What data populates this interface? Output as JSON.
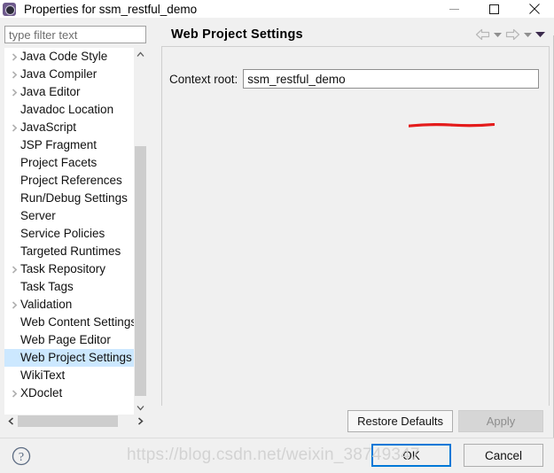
{
  "window": {
    "title": "Properties for ssm_restful_demo",
    "icon": "properties-gear-icon",
    "controls": {
      "minimize": "minimize-icon",
      "maximize": "maximize-icon",
      "close": "close-icon"
    }
  },
  "sidebar": {
    "filter": {
      "placeholder": "type filter text",
      "value": ""
    },
    "items": [
      {
        "label": "Java Code Style",
        "expandable": true,
        "selected": false
      },
      {
        "label": "Java Compiler",
        "expandable": true,
        "selected": false
      },
      {
        "label": "Java Editor",
        "expandable": true,
        "selected": false
      },
      {
        "label": "Javadoc Location",
        "expandable": false,
        "selected": false
      },
      {
        "label": "JavaScript",
        "expandable": true,
        "selected": false
      },
      {
        "label": "JSP Fragment",
        "expandable": false,
        "selected": false
      },
      {
        "label": "Project Facets",
        "expandable": false,
        "selected": false
      },
      {
        "label": "Project References",
        "expandable": false,
        "selected": false
      },
      {
        "label": "Run/Debug Settings",
        "expandable": false,
        "selected": false
      },
      {
        "label": "Server",
        "expandable": false,
        "selected": false
      },
      {
        "label": "Service Policies",
        "expandable": false,
        "selected": false
      },
      {
        "label": "Targeted Runtimes",
        "expandable": false,
        "selected": false
      },
      {
        "label": "Task Repository",
        "expandable": true,
        "selected": false
      },
      {
        "label": "Task Tags",
        "expandable": false,
        "selected": false
      },
      {
        "label": "Validation",
        "expandable": true,
        "selected": false
      },
      {
        "label": "Web Content Settings",
        "expandable": false,
        "selected": false
      },
      {
        "label": "Web Page Editor",
        "expandable": false,
        "selected": false
      },
      {
        "label": "Web Project Settings",
        "expandable": false,
        "selected": true
      },
      {
        "label": "WikiText",
        "expandable": false,
        "selected": false
      },
      {
        "label": "XDoclet",
        "expandable": true,
        "selected": false
      }
    ],
    "scrollbars": {
      "vertical_up": "scroll-up-icon",
      "vertical_down": "scroll-down-icon",
      "horizontal_left": "scroll-left-icon",
      "horizontal_right": "scroll-right-icon"
    }
  },
  "page": {
    "title": "Web Project Settings",
    "nav": {
      "back": "back-arrow-icon",
      "back_menu": "chevron-down-icon",
      "forward": "forward-arrow-icon",
      "forward_menu": "chevron-down-icon",
      "view_menu": "chevron-down-filled-icon"
    },
    "context_root": {
      "label": "Context root:",
      "value": "ssm_restful_demo",
      "placeholder": ""
    }
  },
  "buttons": {
    "restore_defaults": "Restore Defaults",
    "apply": "Apply",
    "apply_enabled": false,
    "ok": "OK",
    "cancel": "Cancel",
    "help": "?"
  },
  "annotation": {
    "underline_color": "#e41b1b"
  },
  "watermark": {
    "text": "https://blog.csdn.net/weixin_38749347"
  },
  "colors": {
    "selection": "#cce8ff",
    "dialog_bg": "#f0f0f0",
    "field_bg": "#ffffff",
    "focus_border": "#0078d7",
    "scroll_thumb": "#cdcdcd"
  }
}
